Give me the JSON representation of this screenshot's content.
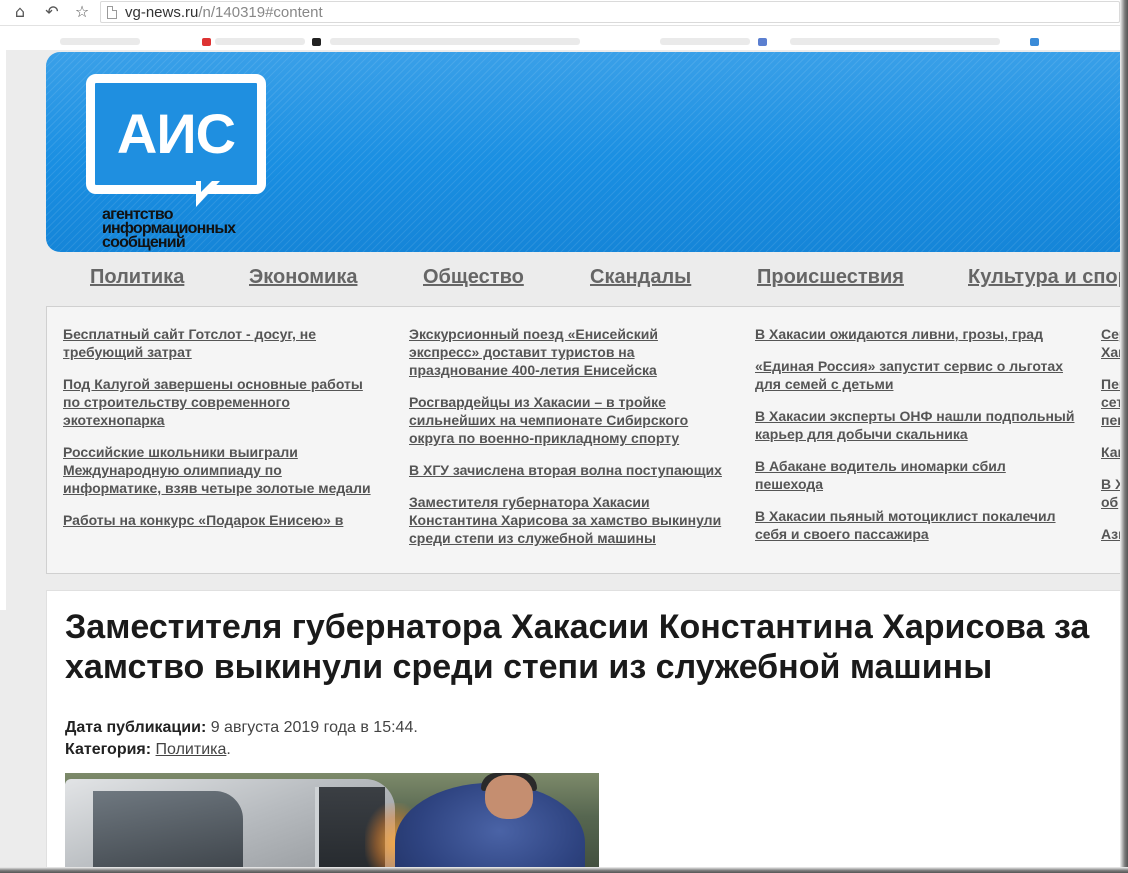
{
  "browser": {
    "url_host": "vg-news.ru",
    "url_path": "/n/140319#content"
  },
  "logo": {
    "abbr": "АИС",
    "line1": "агентство",
    "line2": "информационных",
    "line3": "сообщений"
  },
  "menu": [
    "Политика",
    "Экономика",
    "Общество",
    "Скандалы",
    "Происшествия",
    "Культура и спор"
  ],
  "news_columns": [
    [
      "Бесплатный сайт Готслот - досуг, не требующий затрат",
      "Под Калугой завершены основные работы по строительству современного экотехнопарка",
      "Российские школьники выиграли Международную олимпиаду по информатике, взяв четыре золотые медали",
      "Работы на конкурс «Подарок Енисею» в"
    ],
    [
      "Экскурсионный поезд «Енисейский экспресс» доставит туристов на празднование 400-летия Енисейска",
      "Росгвардейцы из Хакасии – в тройке сильнейших на чемпионате Сибирского округа по военно-прикладному спорту",
      "В ХГУ зачислена вторая волна поступающих",
      "Заместителя губернатора Хакасии Константина Харисова за хамство выкинули среди степи из служебной машины"
    ],
    [
      "В Хакасии ожидаются ливни, грозы, град",
      "«Единая Россия» запустит сервис о льготах для семей с детьми",
      "В Хакасии эксперты ОНФ нашли подпольный карьер для добычи скальника",
      "В Абакане водитель иномарки сбил пешехода",
      "В Хакасии пьяный мотоциклист покалечил себя и своего пассажира"
    ],
    [
      "Сер Хак",
      "Пен сет пен",
      "Как",
      "В Х об",
      "Ази"
    ]
  ],
  "article": {
    "title": "Заместителя губернатора Хакасии Константина Харисова за хамство выкинули среди степи из служебной машины",
    "date_label": "Дата публикации:",
    "date_value": " 9 августа 2019 года в 15:44.",
    "category_label": "Категория:",
    "category_value": "Политика",
    "category_suffix": "."
  }
}
